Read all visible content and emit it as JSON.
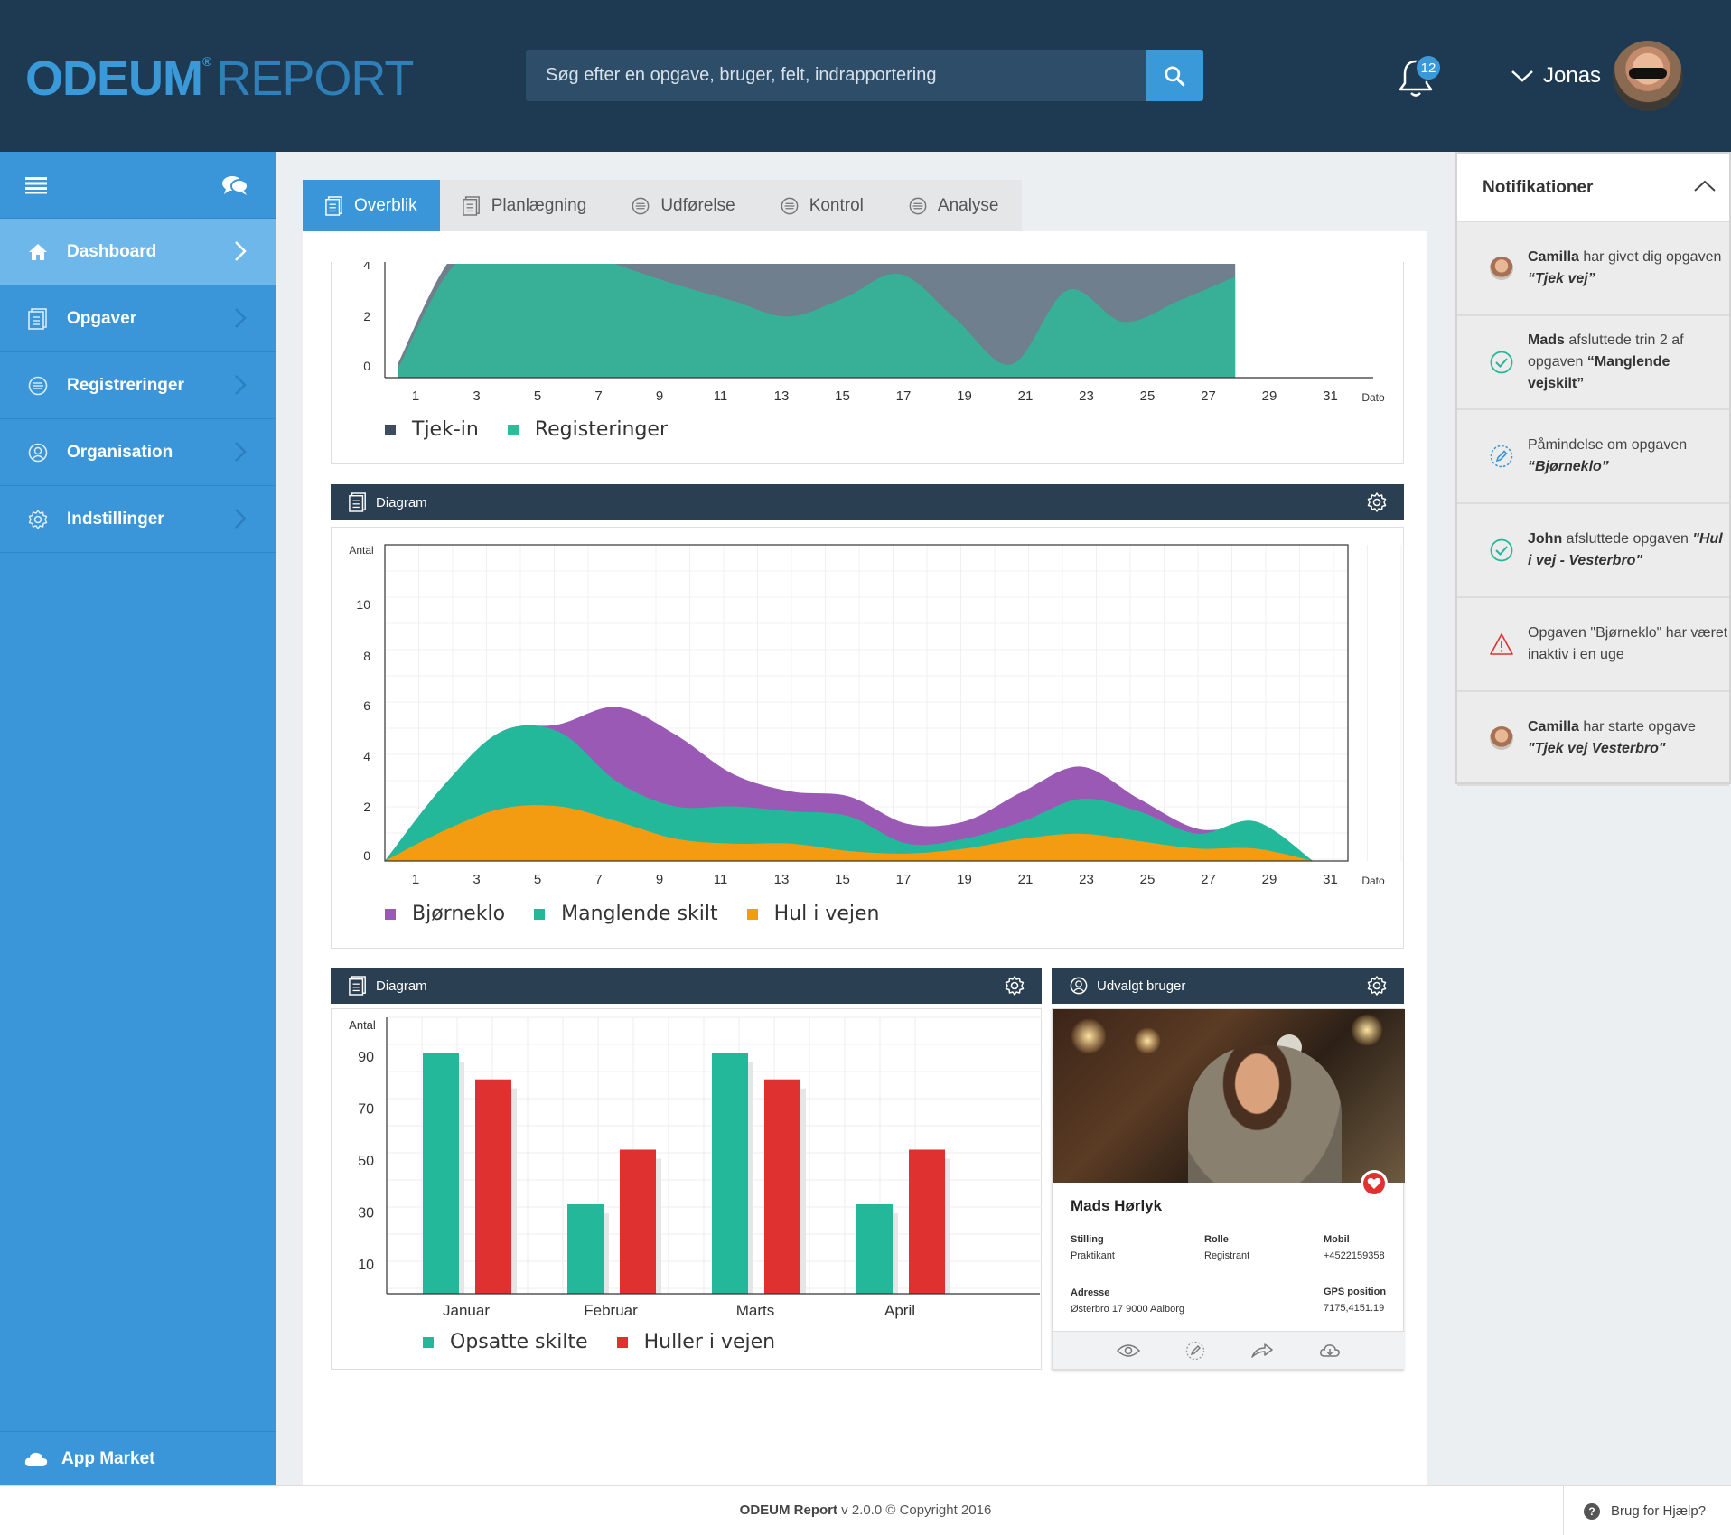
{
  "header": {
    "logo": {
      "main": "ODEUM",
      "mark": "®",
      "sub": "REPORT"
    },
    "search_placeholder": "Søg efter en opgave, bruger, felt, indrapportering",
    "notification_count": "12",
    "user_name": "Jonas"
  },
  "sidebar": {
    "items": [
      {
        "label": "Dashboard",
        "icon": "home-icon"
      },
      {
        "label": "Opgaver",
        "icon": "tasks-icon"
      },
      {
        "label": "Registreringer",
        "icon": "list-circle-icon"
      },
      {
        "label": "Organisation",
        "icon": "user-circle-icon"
      },
      {
        "label": "Indstillinger",
        "icon": "gear-icon"
      }
    ],
    "bottom": "App Market"
  },
  "tabs": [
    {
      "label": "Overblik",
      "icon": "tasks-icon"
    },
    {
      "label": "Planlægning",
      "icon": "tasks-icon"
    },
    {
      "label": "Udførelse",
      "icon": "list-circle-icon"
    },
    {
      "label": "Kontrol",
      "icon": "list-circle-icon"
    },
    {
      "label": "Analyse",
      "icon": "list-circle-icon"
    }
  ],
  "charts": {
    "top": {
      "legend": [
        "Tjek-in",
        "Registeringer"
      ],
      "colors": [
        "#6f7f8e",
        "#2bbd9a"
      ]
    },
    "middle": {
      "title": "Diagram",
      "legend": [
        "Bjørneklo",
        "Manglende skilt",
        "Hul i vejen"
      ],
      "colors": [
        "#9b59b6",
        "#23b899",
        "#f39c12"
      ]
    },
    "bottom": {
      "title": "Diagram",
      "legend": [
        "Opsatte skilte",
        "Huller i vejen"
      ],
      "colors": [
        "#23b899",
        "#e03131"
      ]
    }
  },
  "chart_data": [
    {
      "type": "area",
      "x": [
        1,
        3,
        5,
        7,
        9,
        11,
        13,
        15,
        17,
        19,
        21,
        23,
        25,
        27,
        29,
        31
      ],
      "xlabel": "Dato",
      "ylim": [
        0,
        4
      ],
      "yticks": [
        0,
        2,
        4
      ],
      "series": [
        {
          "name": "Tjek-in",
          "values": [
            0.5,
            4.6,
            5.2,
            5.4,
            5.3,
            4.6,
            4.9,
            5.2,
            5.4,
            5.1,
            5.2,
            4.3,
            5.2,
            5.6,
            5.5,
            5.2
          ]
        },
        {
          "name": "Registeringer",
          "values": [
            0.3,
            4.2,
            4.8,
            5.0,
            4.2,
            3.5,
            2.9,
            2.3,
            3.0,
            3.9,
            2.2,
            0.5,
            3.3,
            2.1,
            2.9,
            3.8
          ]
        }
      ]
    },
    {
      "type": "area",
      "title": "Diagram",
      "x": [
        1,
        3,
        5,
        7,
        9,
        11,
        13,
        15,
        17,
        19,
        21,
        23,
        25,
        27,
        29,
        31,
        33
      ],
      "xticks": [
        1,
        3,
        5,
        7,
        9,
        11,
        13,
        15,
        17,
        19,
        21,
        23,
        25,
        27,
        29,
        31
      ],
      "xlabel": "Dato",
      "ylabel": "Antal",
      "ylim": [
        0,
        12
      ],
      "yticks": [
        0,
        2,
        4,
        6,
        8,
        10
      ],
      "series": [
        {
          "name": "Bjørneklo",
          "values": [
            0,
            3,
            5.2,
            5.5,
            6.2,
            5.1,
            3.5,
            2.8,
            2.6,
            1.5,
            1.6,
            2.8,
            3.8,
            2.5,
            1.3,
            1.3,
            0
          ]
        },
        {
          "name": "Manglende skilt",
          "values": [
            0,
            3,
            5.2,
            5.2,
            3.2,
            2.2,
            2.2,
            2.0,
            1.8,
            0.7,
            0.9,
            1.6,
            2.5,
            2.0,
            1.1,
            1.6,
            0
          ]
        },
        {
          "name": "Hul i vejen",
          "values": [
            0,
            1.2,
            2.1,
            2.2,
            1.6,
            0.9,
            0.7,
            0.7,
            0.4,
            0.3,
            0.5,
            0.9,
            1.1,
            0.8,
            0.5,
            0.5,
            0
          ]
        }
      ]
    },
    {
      "type": "bar",
      "title": "Diagram",
      "categories": [
        "Januar",
        "Februar",
        "Marts",
        "April"
      ],
      "ylabel": "Antal",
      "ylim": [
        0,
        100
      ],
      "yticks": [
        10,
        30,
        50,
        70,
        90
      ],
      "series": [
        {
          "name": "Opsatte skilte",
          "values": [
            91,
            33,
            91,
            33
          ]
        },
        {
          "name": "Huller i vejen",
          "values": [
            81,
            54,
            81,
            54
          ]
        }
      ]
    }
  ],
  "selected_user": {
    "panel_title": "Udvalgt bruger",
    "name": "Mads Hørlyk",
    "fields": [
      {
        "key": "Stilling",
        "value": "Praktikant"
      },
      {
        "key": "Rolle",
        "value": "Registrant"
      },
      {
        "key": "Mobil",
        "value": "+4522159358"
      },
      {
        "key": "Adresse",
        "value": "Østerbro 17 9000 Aalborg"
      },
      {
        "key": "GPS position",
        "value": "7175,4151.19"
      }
    ]
  },
  "notifications": {
    "title": "Notifikationer",
    "items": [
      {
        "icon": "avatar",
        "bold": "Camilla",
        "text": " har givet dig opgaven ",
        "em": "“Tjek vej”"
      },
      {
        "icon": "check-circle-icon",
        "bold": "Mads",
        "text": " afsluttede trin 2 af opgaven ",
        "em": "“Manglende vejskilt”"
      },
      {
        "icon": "pencil-circle-icon",
        "bold": "",
        "text": "Påmindelse om opgaven ",
        "em": "“Bjørneklo”"
      },
      {
        "icon": "check-circle-icon",
        "bold": "John",
        "text": " afsluttede opgaven ",
        "em": "\"Hul i vej - Vesterbro\""
      },
      {
        "icon": "warning-icon",
        "bold": "",
        "text": "Opgaven \"Bjørneklo\" har været inaktiv i en uge",
        "em": ""
      },
      {
        "icon": "avatar",
        "bold": "Camilla",
        "text": " har starte opgave ",
        "em": "\"Tjek vej Vesterbro\""
      }
    ]
  },
  "footer": {
    "brand": "ODEUM Report",
    "version": " v 2.0.0 © Copyright 2016",
    "help": "Brug for Hjælp?"
  }
}
